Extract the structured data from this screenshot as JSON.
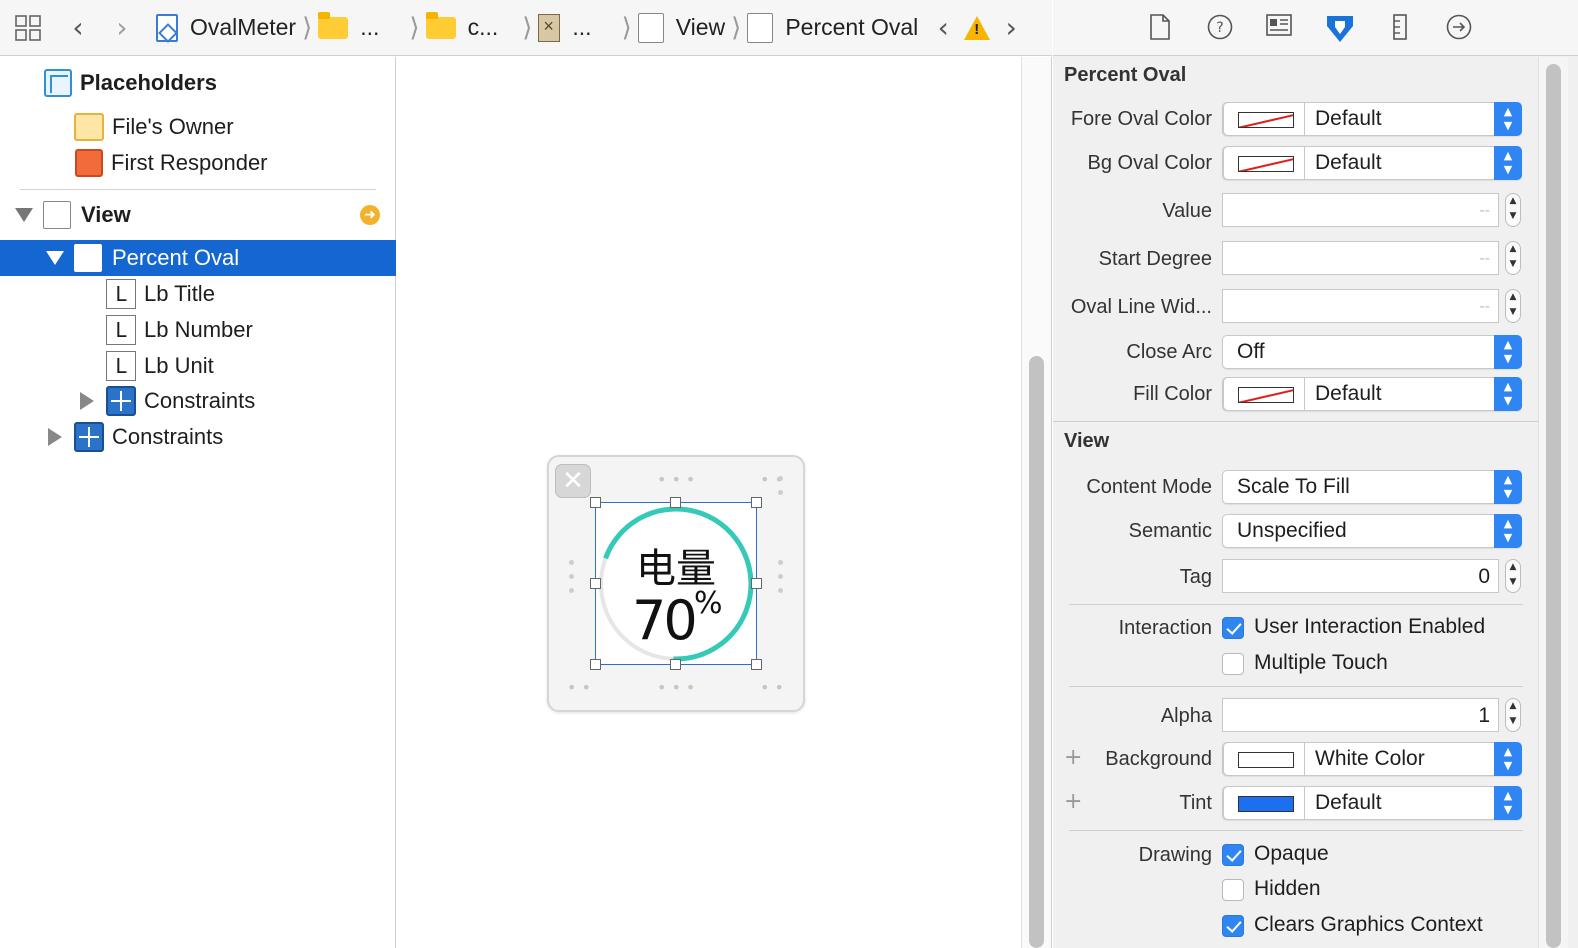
{
  "jumpbar": {
    "crumbs": [
      "OvalMeter",
      "...",
      "c...",
      "...",
      "View",
      "Percent Oval"
    ]
  },
  "outline": {
    "placeholders": "Placeholders",
    "files_owner": "File's Owner",
    "first_responder": "First Responder",
    "view": "View",
    "percent_oval": "Percent Oval",
    "lb_title": "Lb Title",
    "lb_number": "Lb Number",
    "lb_unit": "Lb Unit",
    "constraints_inner": "Constraints",
    "constraints_outer": "Constraints",
    "label_icon_letter": "L"
  },
  "canvas": {
    "title": "电量",
    "number": "70",
    "unit": "%",
    "progress": 0.7,
    "ring_color": "#35c9b8",
    "track_color": "#e6e6e6"
  },
  "inspector": {
    "percent_oval_section": {
      "title": "Percent Oval",
      "fore_oval_color": {
        "label": "Fore Oval Color",
        "value": "Default"
      },
      "bg_oval_color": {
        "label": "Bg Oval Color",
        "value": "Default"
      },
      "value": {
        "label": "Value",
        "placeholder": "--"
      },
      "start_degree": {
        "label": "Start Degree",
        "placeholder": "--"
      },
      "oval_line_width": {
        "label": "Oval Line Wid...",
        "placeholder": "--"
      },
      "close_arc": {
        "label": "Close Arc",
        "value": "Off"
      },
      "fill_color": {
        "label": "Fill Color",
        "value": "Default"
      }
    },
    "view_section": {
      "title": "View",
      "content_mode": {
        "label": "Content Mode",
        "value": "Scale To Fill"
      },
      "semantic": {
        "label": "Semantic",
        "value": "Unspecified"
      },
      "tag": {
        "label": "Tag",
        "value": "0"
      },
      "interaction": {
        "label": "Interaction",
        "user_interaction_enabled": {
          "label": "User Interaction Enabled",
          "checked": true
        },
        "multiple_touch": {
          "label": "Multiple Touch",
          "checked": false
        }
      },
      "alpha": {
        "label": "Alpha",
        "value": "1"
      },
      "background": {
        "label": "Background",
        "value": "White Color",
        "swatch": "#ffffff"
      },
      "tint": {
        "label": "Tint",
        "value": "Default",
        "swatch": "#1d6ff2"
      },
      "drawing": {
        "label": "Drawing",
        "opaque": {
          "label": "Opaque",
          "checked": true
        },
        "hidden": {
          "label": "Hidden",
          "checked": false
        },
        "clears_graphics_context": {
          "label": "Clears Graphics Context",
          "checked": true
        }
      }
    }
  }
}
